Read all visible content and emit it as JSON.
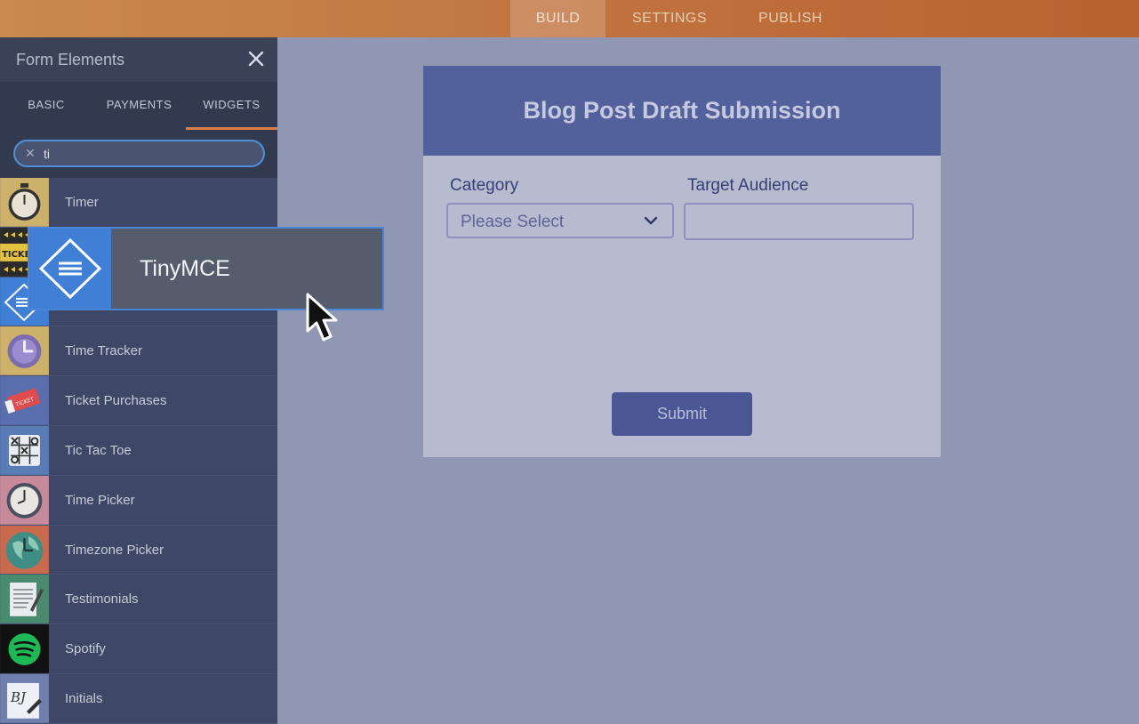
{
  "topbar": {
    "tabs": [
      {
        "label": "BUILD",
        "active": true
      },
      {
        "label": "SETTINGS",
        "active": false
      },
      {
        "label": "PUBLISH",
        "active": false
      }
    ]
  },
  "sidebar": {
    "title": "Form Elements",
    "tabs": [
      {
        "label": "BASIC"
      },
      {
        "label": "PAYMENTS"
      },
      {
        "label": "WIDGETS",
        "active": true
      }
    ],
    "search": {
      "value": "ti"
    },
    "items": [
      {
        "label": "Timer",
        "icon": "stopwatch-icon"
      },
      {
        "label": "",
        "icon": "ticker-icon"
      },
      {
        "label": "",
        "icon": "tinymce-icon"
      },
      {
        "label": "Time Tracker",
        "icon": "time-tracker-icon"
      },
      {
        "label": "Ticket Purchases",
        "icon": "ticket-icon"
      },
      {
        "label": "Tic Tac Toe",
        "icon": "tic-tac-toe-icon"
      },
      {
        "label": "Time Picker",
        "icon": "clock-icon"
      },
      {
        "label": "Timezone Picker",
        "icon": "globe-clock-icon"
      },
      {
        "label": "Testimonials",
        "icon": "testimonial-icon"
      },
      {
        "label": "Spotify",
        "icon": "spotify-icon"
      },
      {
        "label": "Initials",
        "icon": "initials-pen-icon"
      }
    ]
  },
  "drag_ghost": {
    "label": "TinyMCE",
    "icon": "tinymce-icon"
  },
  "form": {
    "title": "Blog Post Draft Submission",
    "fields": [
      {
        "label": "Category",
        "placeholder": "Please Select"
      },
      {
        "label": "Target Audience",
        "value": ""
      }
    ],
    "submit_label": "Submit"
  },
  "colors": {
    "accent": "#52609c",
    "brand_orange": "#c0723e",
    "drag_blue": "#3f7fd6"
  }
}
